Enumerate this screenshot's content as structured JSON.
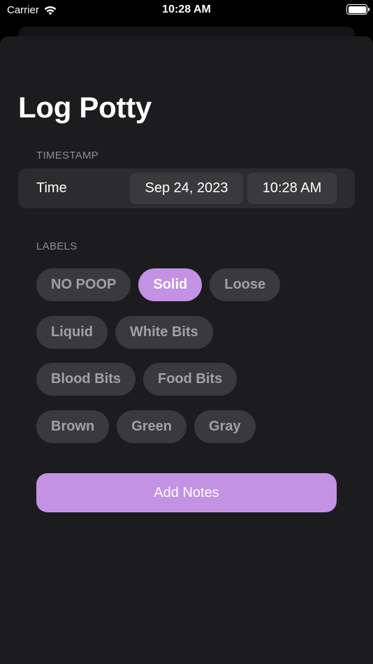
{
  "status_bar": {
    "carrier": "Carrier",
    "time": "10:28 AM",
    "wifi_icon": "wifi-icon",
    "battery_icon": "battery-icon"
  },
  "title": "Log Potty",
  "timestamp_section": {
    "header": "TIMESTAMP",
    "label": "Time",
    "date": "Sep 24, 2023",
    "time": "10:28 AM"
  },
  "labels_section": {
    "header": "LABELS",
    "rows": [
      [
        {
          "label": "NO POOP",
          "selected": false
        },
        {
          "label": "Solid",
          "selected": true
        },
        {
          "label": "Loose",
          "selected": false
        }
      ],
      [
        {
          "label": "Liquid",
          "selected": false
        },
        {
          "label": "White Bits",
          "selected": false
        }
      ],
      [
        {
          "label": "Blood Bits",
          "selected": false
        },
        {
          "label": "Food Bits",
          "selected": false
        }
      ],
      [
        {
          "label": "Brown",
          "selected": false
        },
        {
          "label": "Green",
          "selected": false
        },
        {
          "label": "Gray",
          "selected": false
        }
      ]
    ]
  },
  "add_notes_label": "Add Notes",
  "colors": {
    "background": "#000000",
    "sheet": "#1c1c1e",
    "card": "#2c2c2e",
    "chip": "#3a3a3c",
    "accent": "#c392e4",
    "secondary_text": "#8e8e93"
  }
}
